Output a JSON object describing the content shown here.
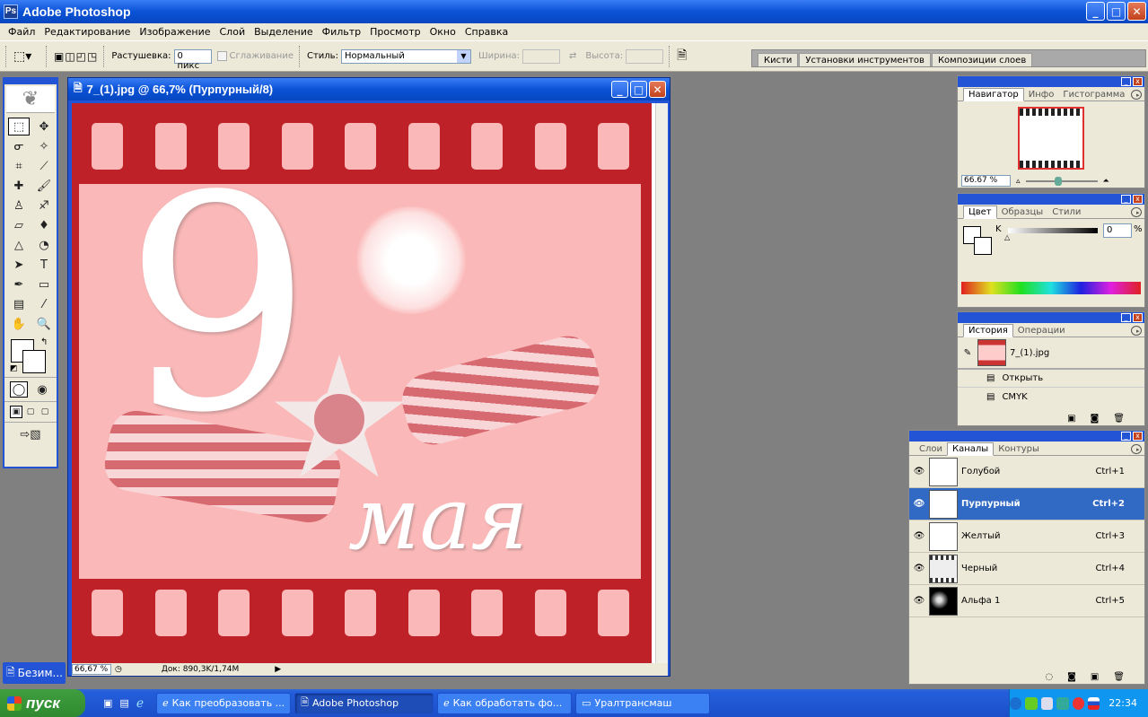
{
  "window": {
    "title": "Adobe Photoshop",
    "min": "_",
    "max": "□",
    "close": "✕"
  },
  "menu": [
    "Файл",
    "Редактирование",
    "Изображение",
    "Слой",
    "Выделение",
    "Фильтр",
    "Просмотр",
    "Окно",
    "Справка"
  ],
  "options": {
    "feather_label": "Растушевка:",
    "feather_value": "0 пикс",
    "antialias_label": "Сглаживание",
    "style_label": "Стиль:",
    "style_value": "Нормальный",
    "width_label": "Ширина:",
    "height_label": "Высота:"
  },
  "palette_well": [
    "Кисти",
    "Установки инструментов",
    "Композиции слоев"
  ],
  "document": {
    "title": "7_(1).jpg @ 66,7% (Пурпурный/8)",
    "zoom": "66,67 %",
    "doc_info": "Док: 890,3K/1,74M",
    "artwork_number": "9",
    "artwork_word": "мая"
  },
  "navigator": {
    "tabs": [
      "Навигатор",
      "Инфо",
      "Гистограмма"
    ],
    "zoom": "66.67 %"
  },
  "color": {
    "tabs": [
      "Цвет",
      "Образцы",
      "Стили"
    ],
    "channel_label": "K",
    "value": "0",
    "unit": "%"
  },
  "history": {
    "tabs": [
      "История",
      "Операции"
    ],
    "snapshot": "7_(1).jpg",
    "items": [
      "Открыть",
      "CMYK"
    ]
  },
  "channels": {
    "tabs": [
      "Слои",
      "Каналы",
      "Контуры"
    ],
    "rows": [
      {
        "name": "Голубой",
        "shortcut": "Ctrl+1"
      },
      {
        "name": "Пурпурный",
        "shortcut": "Ctrl+2"
      },
      {
        "name": "Желтый",
        "shortcut": "Ctrl+3"
      },
      {
        "name": "Черный",
        "shortcut": "Ctrl+4"
      },
      {
        "name": "Альфа 1",
        "shortcut": "Ctrl+5"
      }
    ]
  },
  "minimized_doc": "Безим...",
  "taskbar": {
    "start": "пуск",
    "tasks": [
      "Как преобразовать ...",
      "Adobe Photoshop",
      "Как обработать фо...",
      "Уралтрансмаш"
    ],
    "clock": "22:34"
  }
}
